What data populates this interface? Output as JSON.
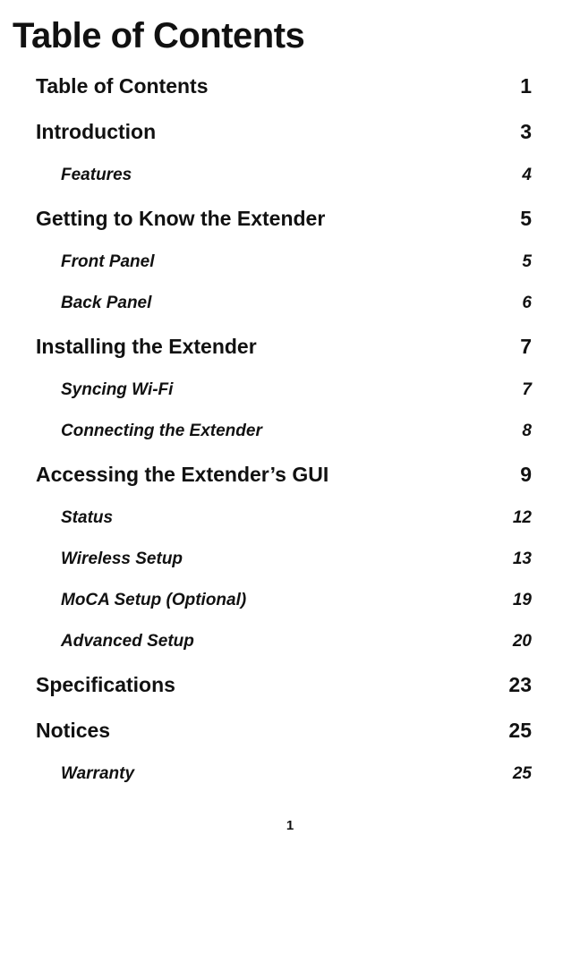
{
  "title": "Table of Contents",
  "toc": [
    {
      "label": "Table of Contents",
      "page": "1",
      "level": 1
    },
    {
      "label": "Introduction",
      "page": "3",
      "level": 1
    },
    {
      "label": "Features",
      "page": "4",
      "level": 2
    },
    {
      "label": "Getting to Know the Extender",
      "page": "5",
      "level": 1
    },
    {
      "label": "Front Panel",
      "page": "5",
      "level": 2
    },
    {
      "label": "Back Panel",
      "page": "6",
      "level": 2
    },
    {
      "label": "Installing the Extender",
      "page": "7",
      "level": 1
    },
    {
      "label": "Syncing Wi-Fi",
      "page": "7",
      "level": 2
    },
    {
      "label": "Connecting the Extender",
      "page": "8",
      "level": 2
    },
    {
      "label": "Accessing the Extender’s GUI",
      "page": "9",
      "level": 1
    },
    {
      "label": "Status",
      "page": "12",
      "level": 2
    },
    {
      "label": "Wireless Setup",
      "page": "13",
      "level": 2
    },
    {
      "label": "MoCA Setup (Optional)",
      "page": "19",
      "level": 2
    },
    {
      "label": "Advanced Setup",
      "page": "20",
      "level": 2
    },
    {
      "label": "Specifications",
      "page": "23",
      "level": 1
    },
    {
      "label": "Notices",
      "page": "25",
      "level": 1
    },
    {
      "label": "Warranty",
      "page": "25",
      "level": 2
    }
  ],
  "page_number": "1"
}
